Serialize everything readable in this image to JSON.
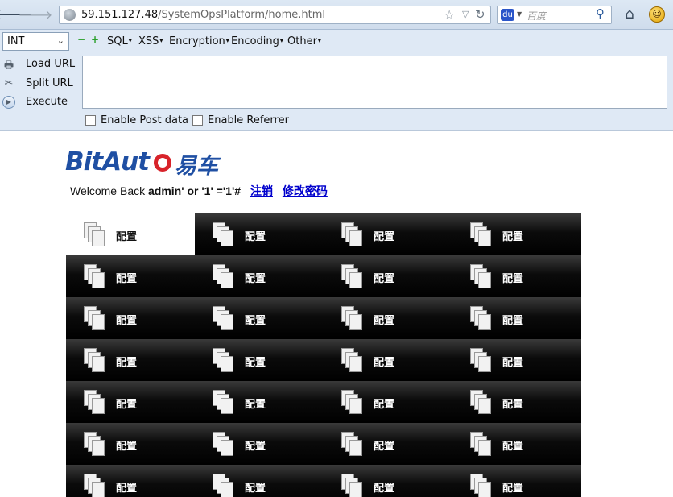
{
  "browser": {
    "url_host": "59.151.127.48",
    "url_path": "/SystemOpsPlatform/home.html",
    "search_placeholder": "百度",
    "engine_icon_text": "du"
  },
  "hackbar": {
    "select_value": "INT",
    "menus": [
      "SQL",
      "XSS",
      "Encryption",
      "Encoding",
      "Other"
    ],
    "actions": [
      "Load URL",
      "Split URL",
      "Execute"
    ],
    "checkboxes": [
      "Enable Post data",
      "Enable Referrer"
    ]
  },
  "page": {
    "logo_latin": "BitAut",
    "logo_cn": "易车",
    "welcome_prefix": "Welcome Back",
    "welcome_user": "admin' or '1' ='1'#",
    "logout_link": "注销",
    "change_password_link": "修改密码"
  },
  "tiles": {
    "label": "配置",
    "columns": 4,
    "rows": 7,
    "active_index": 0
  },
  "colors": {
    "tile_bg": "#000000",
    "tile_active_bg": "#ffffff",
    "link": "#0000cc",
    "logo_blue": "#1f4fa3",
    "logo_red": "#d8232a"
  }
}
